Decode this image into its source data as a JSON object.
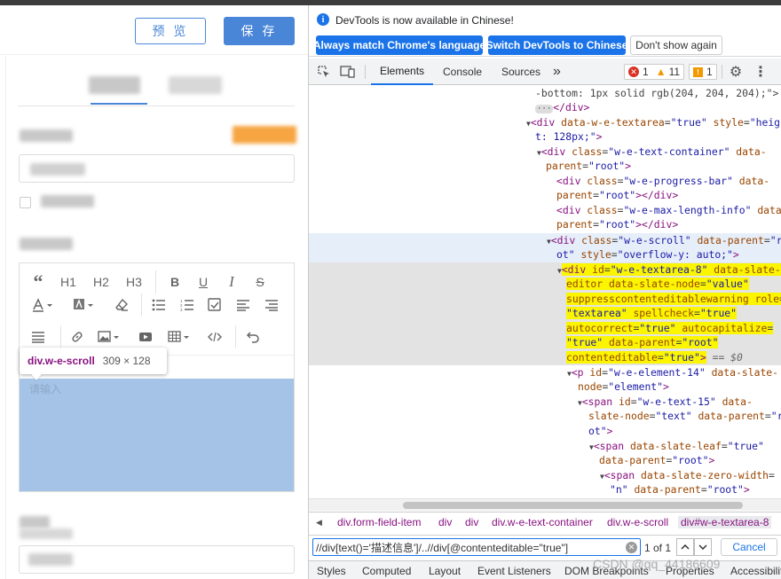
{
  "app": {
    "preview_label": "预 览",
    "save_label": "保 存",
    "editor": {
      "toolbar_row1": [
        "“",
        "H1",
        "H2",
        "H3",
        "B",
        "U",
        "I",
        "S"
      ],
      "placeholder": "请输入"
    },
    "tooltip": {
      "selector": "div.w-e-scroll",
      "dimensions": "309 × 128"
    }
  },
  "devtools": {
    "infobar": {
      "message": "DevTools is now available in Chinese!",
      "btn_match": "Always match Chrome's language",
      "btn_switch": "Switch DevTools to Chinese",
      "btn_dont_show": "Don't show again"
    },
    "tabs": [
      "Elements",
      "Console",
      "Sources",
      "»"
    ],
    "badges": {
      "errors": "1",
      "warnings": "11",
      "info": "1"
    },
    "crumbs": [
      "div.form-field-item",
      "div",
      "div",
      "div.w-e-text-container",
      "div.w-e-scroll",
      "div#w-e-textarea-8"
    ],
    "search": {
      "query": "//div[text()='描述信息']/..//div[@contenteditable=\"true\"]",
      "count": "1 of 1",
      "cancel": "Cancel"
    },
    "drawer_tabs": [
      "Styles",
      "Computed",
      "Layout",
      "Event Listeners",
      "DOM Breakpoints",
      "Properties",
      "Accessibility"
    ]
  },
  "watermark": "CSDN @qq_44186609",
  "colors": {
    "accent": "#4a86d8",
    "chrome_blue": "#1a73e8",
    "highlight": "#fbf500",
    "scroll_overlay": "#a4c3e6"
  }
}
